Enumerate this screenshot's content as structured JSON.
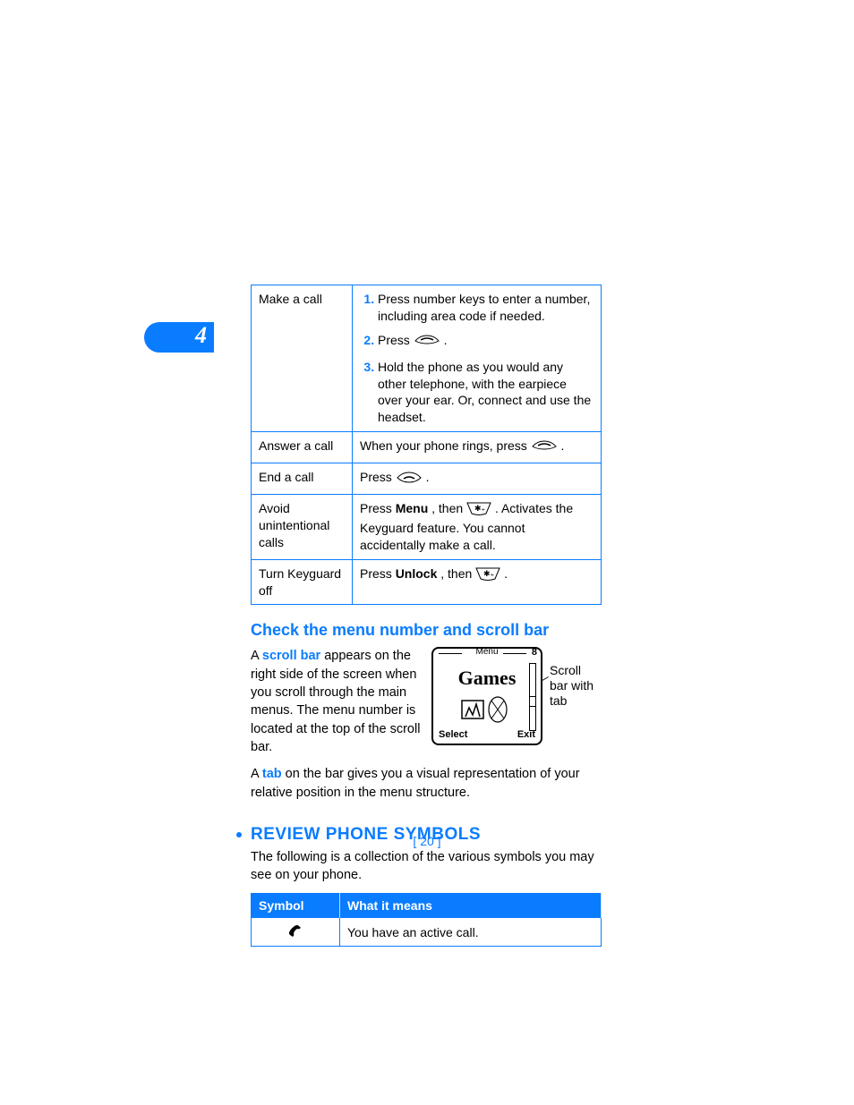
{
  "chapter_number": "4",
  "actions_table": {
    "r1_label": "Make a call",
    "step1": "Press number keys to enter a number, including area code if needed.",
    "step2_pre": "Press ",
    "step2_post": ".",
    "step3": "Hold the phone as you would any other telephone, with the earpiece over your ear. Or, connect and use the headset.",
    "r2_label": "Answer a call",
    "r2_pre": "When your phone rings, press ",
    "r2_post": ".",
    "r3_label": "End a call",
    "r3_pre": "Press ",
    "r3_post": ".",
    "r4_label": "Avoid unintentional calls",
    "r4_pre": "Press ",
    "r4_bold": "Menu",
    "r4_mid": ", then ",
    "r4_post": ". Activates the Keyguard feature. You cannot accidentally make a call.",
    "r5_label": "Turn Keyguard off",
    "r5_pre": "Press ",
    "r5_bold": "Unlock",
    "r5_mid": ", then ",
    "r5_post": "."
  },
  "sec1_heading": "Check the menu number and scroll bar",
  "sec1_p1_a": "A ",
  "sec1_p1_term1": "scroll bar",
  "sec1_p1_b": " appears on the right side of the screen when you scroll through the main menus. The menu number is located at the top of the scroll bar.",
  "sec1_p2_a": "A ",
  "sec1_p2_term": "tab",
  "sec1_p2_b": " on the bar gives you a visual representation of your relative position in the menu structure.",
  "phone": {
    "menu_label": "Menu",
    "menu_number": "8",
    "title": "Games",
    "soft_left": "Select",
    "soft_right": "Exit",
    "callout": "Scroll bar with tab"
  },
  "sec2_heading": "REVIEW PHONE SYMBOLS",
  "sec2_intro": "The following is a collection of the various symbols you may see on your phone.",
  "symbols_table": {
    "col1": "Symbol",
    "col2": "What it means",
    "row1_meaning": "You have an active call."
  },
  "page_number": "[ 20 ]"
}
